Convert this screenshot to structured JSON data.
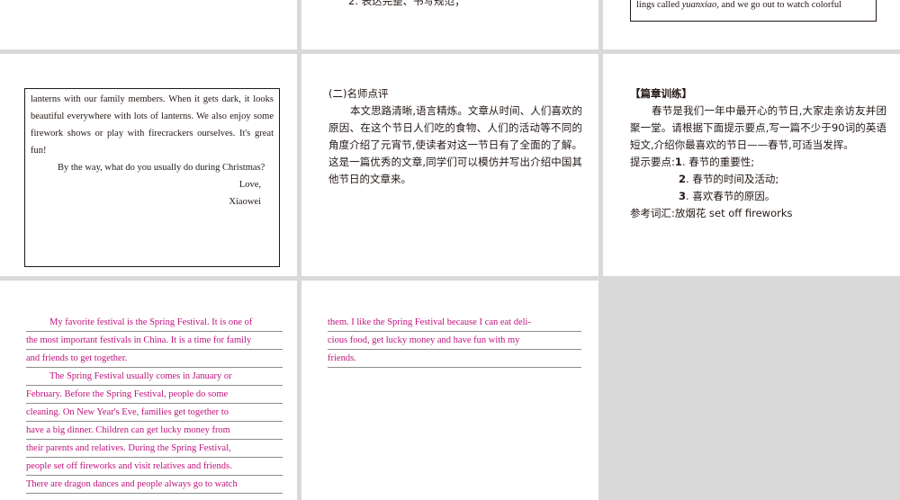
{
  "top_middle": {
    "line": "2. 表达完整、书写规范；"
  },
  "top_right": {
    "line_pre": "lings called ",
    "line_italic": "yuanxiao",
    "line_post": ", and we go out to watch colorful"
  },
  "letter": {
    "p1": "lanterns with our family members. When it gets dark, it looks beautiful everywhere with lots of lanterns. We also enjoy some firework shows or play with firecrackers ourselves. It's great fun!",
    "p2": "By the way, what do you usually do during Christmas?",
    "closing": "Love,",
    "signature": "Xiaowei"
  },
  "review": {
    "heading": "(二)名师点评",
    "body": "本文思路清晰,语言精炼。文章从时间、人们喜欢的原因、在这个节日人们吃的食物、人们的活动等不同的角度介绍了元宵节,使读者对这一节日有了全面的了解。这是一篇优秀的文章,同学们可以模仿并写出介绍中国其他节日的文章来。"
  },
  "training": {
    "heading": "【篇章训练】",
    "body": "春节是我们一年中最开心的节日,大家走亲访友并团聚一堂。请根据下面提示要点,写一篇不少于90词的英语短文,介绍你最喜欢的节日——春节,可适当发挥。",
    "points_label": "提示要点:",
    "points": [
      {
        "num": "1",
        "text": ". 春节的重要性;"
      },
      {
        "num": "2",
        "text": ". 春节的时间及活动;"
      },
      {
        "num": "3",
        "text": ". 喜欢春节的原因。"
      }
    ],
    "vocab": "参考词汇:放烟花 set off fireworks"
  },
  "essay_left": [
    "My favorite festival is the Spring Festival. It is one of",
    "the most important festivals in China. It is a time for family",
    "and friends to get together.",
    "The Spring Festival usually comes in January or",
    "February. Before the Spring Festival, people do some",
    "cleaning. On New Year's Eve, families get together to",
    "have a big dinner. Children can get lucky money from",
    "their parents and relatives. During the Spring Festival,",
    "people set off fireworks and visit relatives and friends.",
    "There are dragon dances and people always go to watch"
  ],
  "essay_right": [
    "them. I like the Spring Festival because I can eat deli-",
    "cious food, get lucky money and have fun with my",
    "friends."
  ],
  "colors": {
    "answer": "#c0127c",
    "panel_bg": "#d9d9d9"
  }
}
